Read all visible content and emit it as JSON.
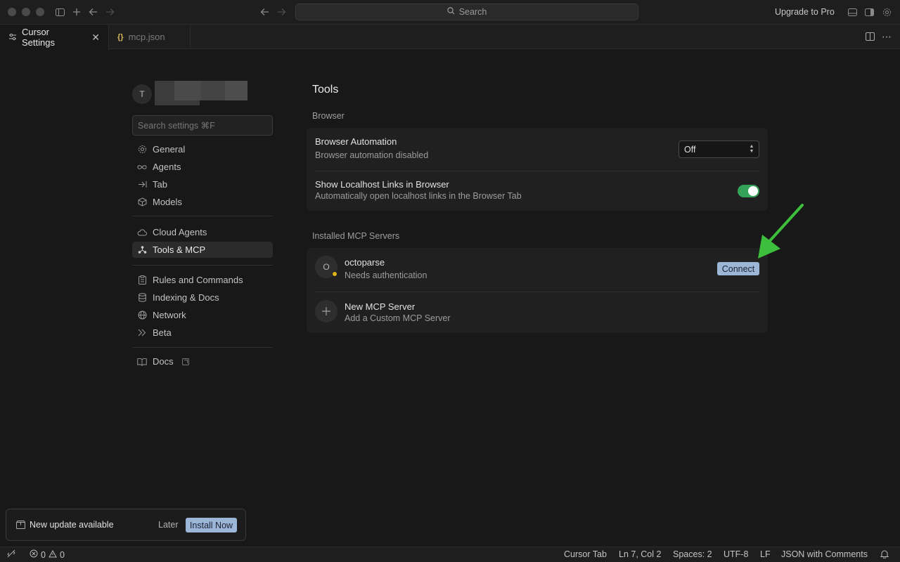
{
  "titlebar": {
    "search_placeholder": "Search",
    "upgrade_label": "Upgrade to Pro"
  },
  "tabs": [
    {
      "label": "Cursor Settings",
      "active": true
    },
    {
      "label": "mcp.json",
      "active": false,
      "icon": "{}"
    }
  ],
  "sidebar": {
    "avatar_initial": "T",
    "search_placeholder": "Search settings ⌘F",
    "groups": [
      [
        {
          "label": "General",
          "icon": "gear-icon"
        },
        {
          "label": "Agents",
          "icon": "infinity-icon"
        },
        {
          "label": "Tab",
          "icon": "arrow-to-line-icon"
        },
        {
          "label": "Models",
          "icon": "cube-icon"
        }
      ],
      [
        {
          "label": "Cloud Agents",
          "icon": "cloud-icon"
        },
        {
          "label": "Tools & MCP",
          "icon": "network-nodes-icon",
          "active": true
        }
      ],
      [
        {
          "label": "Rules and Commands",
          "icon": "clipboard-icon"
        },
        {
          "label": "Indexing & Docs",
          "icon": "database-icon"
        },
        {
          "label": "Network",
          "icon": "globe-icon"
        },
        {
          "label": "Beta",
          "icon": "double-chevron-icon"
        }
      ],
      [
        {
          "label": "Docs",
          "icon": "book-icon",
          "external": true
        }
      ]
    ]
  },
  "main": {
    "title": "Tools",
    "browser": {
      "section_label": "Browser",
      "automation_title": "Browser Automation",
      "automation_subtitle": "Browser automation disabled",
      "automation_value": "Off",
      "localhost_title": "Show Localhost Links in Browser",
      "localhost_subtitle": "Automatically open localhost links in the Browser Tab",
      "localhost_enabled": true
    },
    "mcp": {
      "section_label": "Installed MCP Servers",
      "servers": [
        {
          "avatar": "O",
          "name": "octoparse",
          "status": "Needs authentication",
          "status_color": "#e0b417",
          "action": "Connect"
        }
      ],
      "new_server_title": "New MCP Server",
      "new_server_subtitle": "Add a Custom MCP Server"
    }
  },
  "toast": {
    "message": "New update available",
    "later_label": "Later",
    "install_label": "Install Now"
  },
  "statusbar": {
    "errors": "0",
    "warnings": "0",
    "cursor_tab": "Cursor Tab",
    "position": "Ln 7, Col 2",
    "spaces": "Spaces: 2",
    "encoding": "UTF-8",
    "eol": "LF",
    "language": "JSON with Comments"
  },
  "colors": {
    "accent_button": "#9cb6d8",
    "toggle_on": "#35a259",
    "annotation_arrow": "#3dbf3d",
    "warning_dot": "#e0b417"
  }
}
